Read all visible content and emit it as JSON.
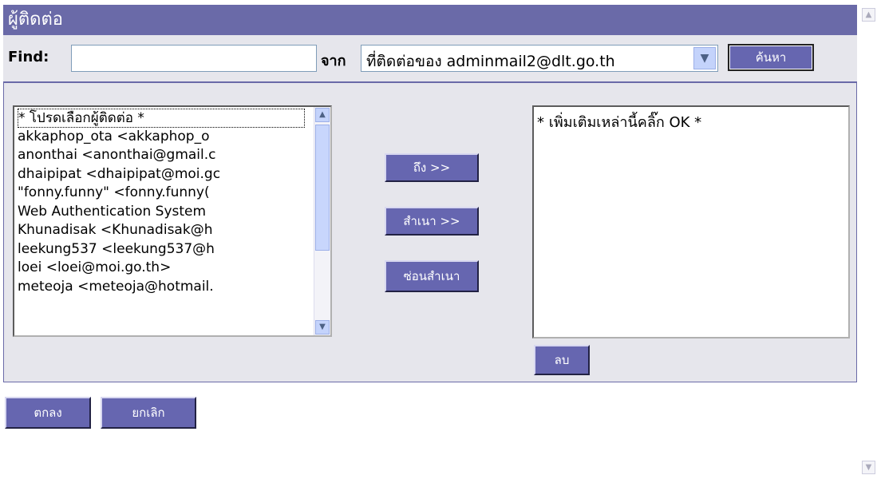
{
  "title": "ผู้ติดต่อ",
  "find": {
    "label": "Find:",
    "value": "",
    "from_label": "จาก",
    "from_selected": "ที่ติดต่อของ adminmail2@dlt.go.th",
    "search_button": "ค้นหา"
  },
  "contacts": {
    "items": [
      "* โปรดเลือกผู้ติดต่อ *",
      "akkaphop_ota <akkaphop_o",
      "anonthai <anonthai@gmail.c",
      "dhaipipat <dhaipipat@moi.gc",
      "\"fonny.funny\" <fonny.funny(",
      "Web Authentication System",
      "Khunadisak <Khunadisak@h",
      "leekung537 <leekung537@h",
      "loei <loei@moi.go.th>",
      "meteoja <meteoja@hotmail."
    ]
  },
  "actions": {
    "to": "ถึง >>",
    "cc": "สำเนา >>",
    "bcc": "ซ่อนสำเนา",
    "delete": "ลบ"
  },
  "recipients": {
    "text": "* เพิ่มเติมเหล่านี้คลิ๊ก OK *"
  },
  "footer": {
    "ok": "ตกลง",
    "cancel": "ยกเลิก"
  },
  "colors": {
    "header": "#6a6aa8",
    "button": "#6666b0",
    "panel": "#e6e6ec"
  }
}
